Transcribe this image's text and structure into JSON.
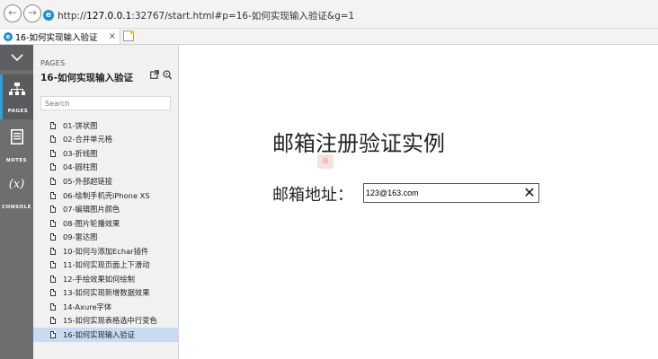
{
  "browser": {
    "url_prefix": "http://",
    "url_host": "127.0.0.1",
    "url_rest": ":32767/start.html#p=16-如何实现输入验证&g=1",
    "tab_title": "16-如何实现输入验证",
    "tab_close": "×",
    "back_icon": "back-arrow-icon",
    "forward_icon": "forward-arrow-icon"
  },
  "rail": {
    "toggle_glyph": "⌄",
    "items": [
      {
        "label": "PAGES",
        "glyph": "⊞"
      },
      {
        "label": "NOTES",
        "glyph": "▤"
      },
      {
        "label": "CONSOLE",
        "glyph": "(x)"
      }
    ],
    "accent": "#2f9fd8"
  },
  "panel": {
    "heading": "PAGES",
    "title": "16-如何实现输入验证",
    "search_placeholder": "Search",
    "pages": [
      {
        "label": "01-饼状图"
      },
      {
        "label": "02-合并单元格"
      },
      {
        "label": "03-折线图"
      },
      {
        "label": "04-圆柱图"
      },
      {
        "label": "05-外部超链接"
      },
      {
        "label": "06-绘制手机壳iPhone XS"
      },
      {
        "label": "07-编辑图片颜色"
      },
      {
        "label": "08-图片轮播效果"
      },
      {
        "label": "09-雷达图"
      },
      {
        "label": "10-如何与添加Echar插件"
      },
      {
        "label": "11-如何实现页面上下滑动"
      },
      {
        "label": "12-手绘效果如何绘制"
      },
      {
        "label": "13-如何实现新增数据效果"
      },
      {
        "label": "14-Axure字体"
      },
      {
        "label": "15-如何实现表格选中行变色"
      },
      {
        "label": "16-如何实现输入验证",
        "selected": true
      }
    ]
  },
  "content": {
    "title": "邮箱注册验证实例",
    "email_label": "邮箱地址：",
    "email_value": "123@163.com",
    "clear_glyph": "✕"
  }
}
